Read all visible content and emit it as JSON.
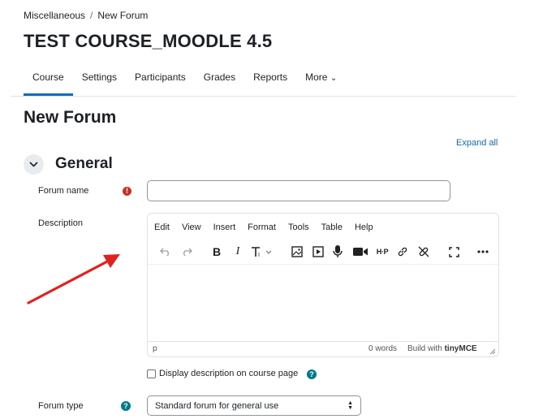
{
  "breadcrumb": {
    "items": [
      "Miscellaneous",
      "New Forum"
    ],
    "separator": "/"
  },
  "course": {
    "title": "TEST COURSE_MOODLE 4.5"
  },
  "nav": {
    "tabs": [
      "Course",
      "Settings",
      "Participants",
      "Grades",
      "Reports",
      "More"
    ],
    "more_icon": "⌄",
    "active": "Course"
  },
  "page": {
    "title": "New Forum",
    "expand_all": "Expand all"
  },
  "section": {
    "title": "General",
    "toggle_icon": "chevron-down-icon"
  },
  "form": {
    "forum_name": {
      "label": "Forum name",
      "value": "",
      "required_icon": "!"
    },
    "description": {
      "label": "Description",
      "menu": [
        "Edit",
        "View",
        "Insert",
        "Format",
        "Tools",
        "Table",
        "Help"
      ],
      "toolbar": [
        "undo",
        "redo",
        "bold",
        "italic",
        "text-format",
        "image",
        "media",
        "microphone",
        "video",
        "h5p",
        "link",
        "unlink",
        "fullscreen",
        "more"
      ],
      "status": {
        "path": "p",
        "words": "0 words",
        "built_with": "Build with",
        "brand": "tinyMCE"
      }
    },
    "display_description": {
      "label": "Display description on course page",
      "checked": false,
      "help": "?"
    },
    "forum_type": {
      "label": "Forum type",
      "value": "Standard forum for general use",
      "help": "?"
    }
  },
  "annotation": {
    "arrow_color": "#e0231c"
  },
  "colors": {
    "accent": "#0f6cbf",
    "required": "#ca3120",
    "help": "#007a8c"
  }
}
